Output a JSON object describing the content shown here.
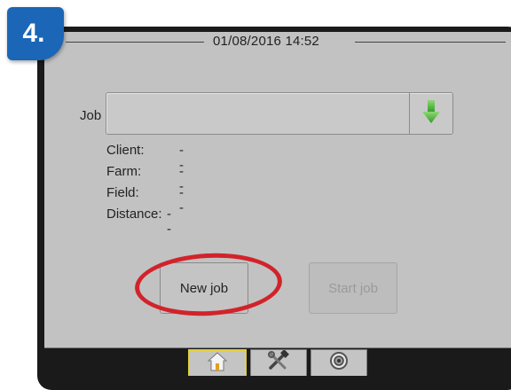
{
  "step": {
    "label": "4."
  },
  "header": {
    "datetime": "01/08/2016 14:52"
  },
  "job": {
    "label": "Job",
    "selected_value": "",
    "dropdown_icon": "green-down-arrow-icon"
  },
  "job_details": [
    {
      "label": "Client:",
      "value": "--"
    },
    {
      "label": "Farm:",
      "value": "--"
    },
    {
      "label": "Field:",
      "value": "--"
    },
    {
      "label": "Distance:",
      "value": "--"
    }
  ],
  "buttons": {
    "new_job": "New job",
    "start_job": "Start job"
  },
  "tabs": [
    {
      "name": "home",
      "icon": "home-icon",
      "active": true
    },
    {
      "name": "tools",
      "icon": "tools-icon",
      "active": false
    },
    {
      "name": "gauge",
      "icon": "gauge-icon",
      "active": false
    }
  ],
  "colors": {
    "screen_bg": "#c2c2c2",
    "badge": "#1b66b6",
    "highlight": "#d2232a",
    "active_tab": "#e2cf3a",
    "arrow": "#4fb23c"
  }
}
